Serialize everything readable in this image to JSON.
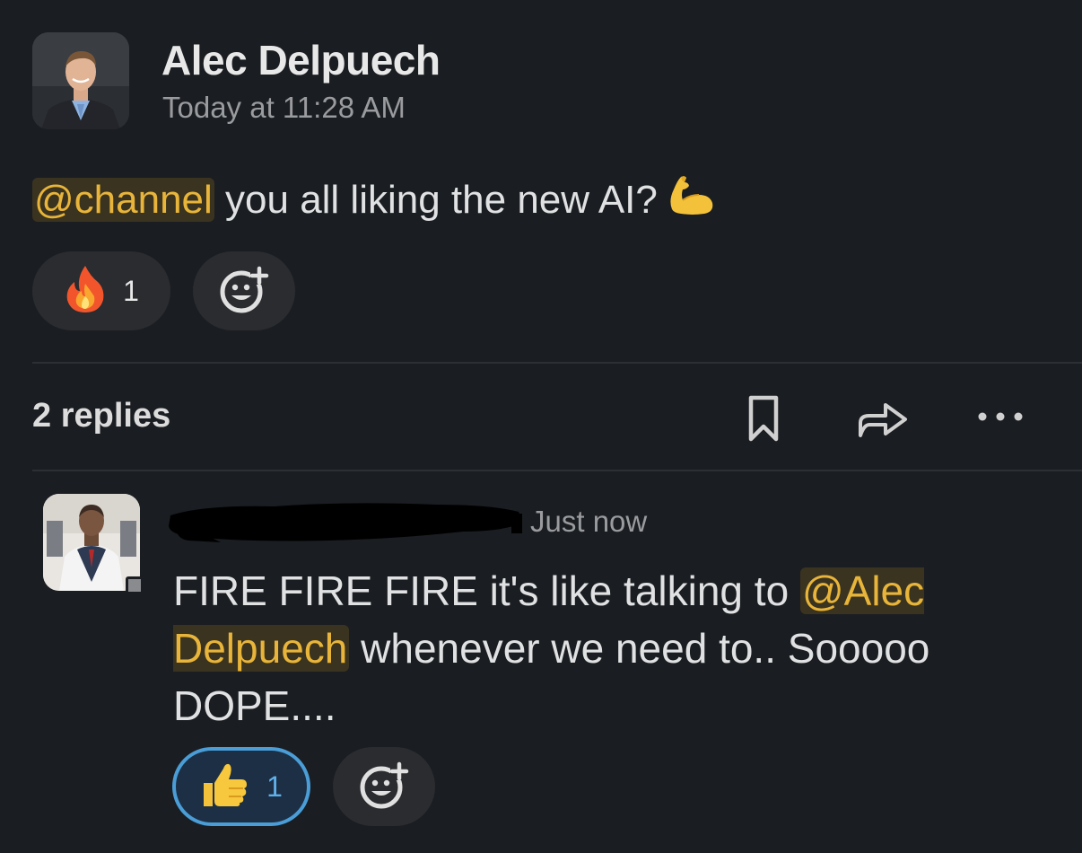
{
  "message": {
    "author": "Alec Delpuech",
    "timestamp": "Today at 11:28 AM",
    "mention": "@channel",
    "text": " you all liking the new AI?",
    "emoji_icon": "flexed-biceps-icon",
    "reactions": [
      {
        "emoji": "fire-icon",
        "count": "1"
      }
    ]
  },
  "thread": {
    "replies_label": "2 replies",
    "actions": [
      "bookmark-icon",
      "share-icon",
      "more-icon"
    ]
  },
  "reply": {
    "author_redacted": true,
    "timestamp": "Just now",
    "text_before": "FIRE FIRE FIRE it's like talking to ",
    "mention": "@Alec Delpuech",
    "text_after": " whenever we need to.. Sooooo DOPE....",
    "reactions": [
      {
        "emoji": "thumbs-up-icon",
        "count": "1",
        "active": true
      }
    ]
  },
  "colors": {
    "background": "#1a1d21",
    "mention_text": "#e8b53a",
    "mention_bg": "#3a3320",
    "active_reaction_border": "#4a9dd6"
  }
}
